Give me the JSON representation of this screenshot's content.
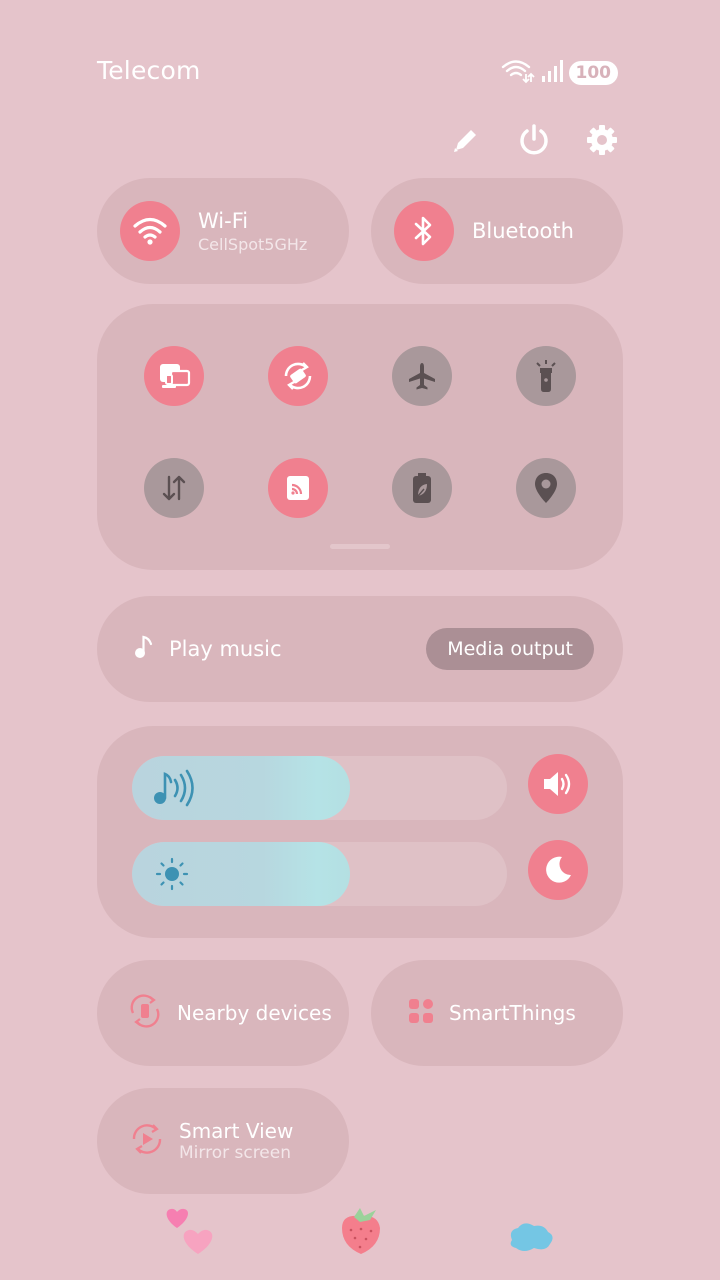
{
  "status_bar": {
    "carrier": "Telecom",
    "battery": "100",
    "icons": [
      "wifi-icon",
      "signal-icon"
    ]
  },
  "top_actions": [
    "edit-icon",
    "power-icon",
    "settings-icon"
  ],
  "tiles": {
    "wifi": {
      "title": "Wi-Fi",
      "subtitle": "CellSpot5GHz",
      "state": "on"
    },
    "bluetooth": {
      "title": "Bluetooth",
      "state": "on"
    }
  },
  "quick_toggles": [
    {
      "name": "link-to-windows",
      "icon": "devices-icon",
      "state": "on"
    },
    {
      "name": "auto-rotate",
      "icon": "rotate-icon",
      "state": "on"
    },
    {
      "name": "airplane-mode",
      "icon": "airplane-icon",
      "state": "off"
    },
    {
      "name": "flashlight",
      "icon": "flashlight-icon",
      "state": "off"
    },
    {
      "name": "mobile-data",
      "icon": "data-arrows-icon",
      "state": "off"
    },
    {
      "name": "cast",
      "icon": "cast-icon",
      "state": "on"
    },
    {
      "name": "power-saving",
      "icon": "battery-leaf-icon",
      "state": "off"
    },
    {
      "name": "location",
      "icon": "location-icon",
      "state": "off"
    }
  ],
  "media": {
    "play_label": "Play music",
    "output_label": "Media output"
  },
  "sliders": {
    "volume_level": 0.58,
    "brightness_level": 0.58
  },
  "shortcuts": {
    "nearby": "Nearby devices",
    "smartthings": "SmartThings",
    "smart_view": {
      "title": "Smart View",
      "subtitle": "Mirror screen"
    }
  },
  "colors": {
    "background": "#e5c4cb",
    "panel": "#d9b6bc",
    "accent": "#f0808f",
    "off": "#a9989b"
  }
}
